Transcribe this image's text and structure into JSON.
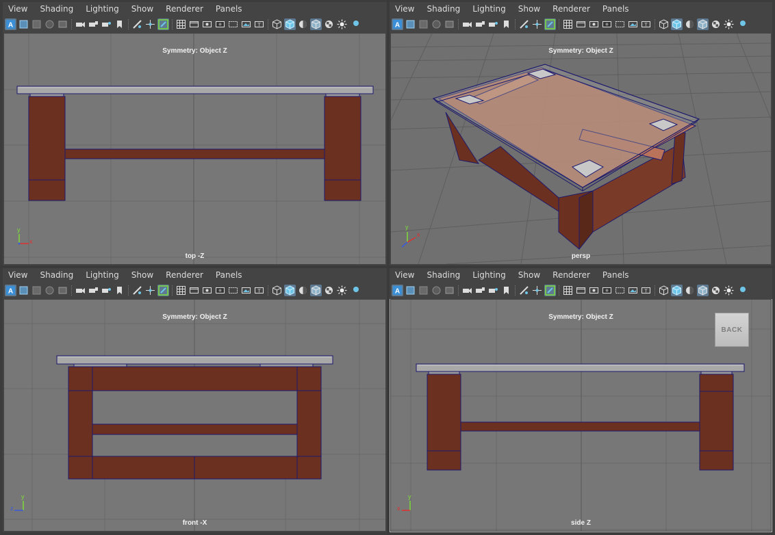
{
  "menus": [
    "View",
    "Shading",
    "Lighting",
    "Show",
    "Renderer",
    "Panels"
  ],
  "toolbar_icons": [
    {
      "name": "select-all-icon",
      "on": true
    },
    {
      "name": "select-frame-icon",
      "on": false
    },
    {
      "name": "grid-square-icon",
      "on": false
    },
    {
      "name": "sphere-dark-icon",
      "on": false
    },
    {
      "name": "image-icon",
      "on": false
    },
    {
      "sep": true
    },
    {
      "name": "camera-icon",
      "on": false
    },
    {
      "name": "camera-lock-icon",
      "on": false
    },
    {
      "name": "camera-attr-icon",
      "on": false
    },
    {
      "name": "bookmark-icon",
      "on": false
    },
    {
      "sep": true
    },
    {
      "name": "ruler-icon",
      "on": false
    },
    {
      "name": "pan-icon",
      "on": false
    },
    {
      "name": "pencil-icon",
      "on": true
    },
    {
      "sep": true
    },
    {
      "name": "grid-icon",
      "on": false
    },
    {
      "name": "film-gate-icon",
      "on": false
    },
    {
      "name": "resolution-gate-icon",
      "on": false
    },
    {
      "name": "gate-mask-icon",
      "on": false
    },
    {
      "name": "field-chart-icon",
      "on": false
    },
    {
      "name": "safe-action-icon",
      "on": false
    },
    {
      "name": "safe-title-icon",
      "on": false
    },
    {
      "sep": true
    },
    {
      "name": "wireframe-cube-icon",
      "on": false
    },
    {
      "name": "shaded-cube-icon",
      "on": true
    },
    {
      "name": "half-shaded-icon",
      "on": false
    },
    {
      "name": "xray-cube-icon",
      "on": true
    },
    {
      "name": "checker-icon",
      "on": false
    },
    {
      "name": "light-icon",
      "on": false
    },
    {
      "name": "shadow-icon",
      "on": false
    }
  ],
  "panels": {
    "top": {
      "symmetry": "Symmetry: Object Z",
      "camera": "top -Z",
      "axis": {
        "up": "y",
        "right": "x"
      }
    },
    "persp": {
      "symmetry": "Symmetry: Object Z",
      "camera": "persp",
      "axis": {
        "up": "y",
        "right": "x"
      }
    },
    "front": {
      "symmetry": "Symmetry: Object Z",
      "camera": "front -X",
      "axis": {
        "up": "y",
        "right": "z"
      }
    },
    "side": {
      "symmetry": "Symmetry: Object Z",
      "camera": "side Z",
      "axis": {
        "up": "y",
        "right": "x"
      },
      "back_button": "BACK"
    }
  },
  "colors": {
    "viewport_bg": "#777777",
    "grid": "#666666",
    "wood": "#6b3020",
    "wood_light": "#c07a5c",
    "glass": "#a6a6a6",
    "edge": "#1d1a6e"
  }
}
